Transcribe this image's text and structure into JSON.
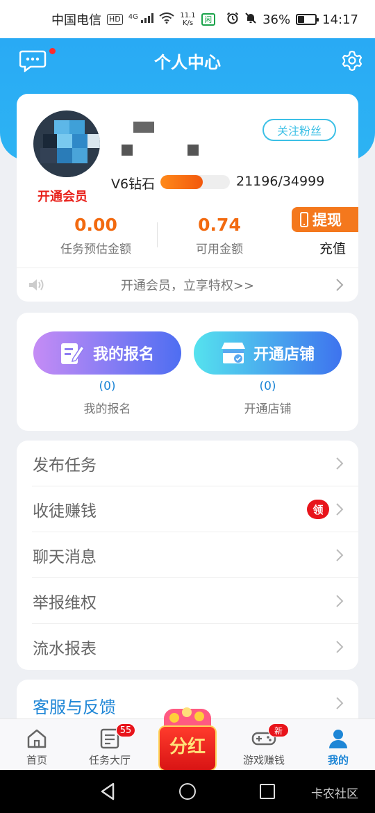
{
  "status_bar": {
    "carrier": "中国电信",
    "hd": "HD",
    "network": "4G",
    "speed_value": "11.1",
    "speed_unit": "K/s",
    "app_icon_text": "闲",
    "battery_percent": "36%",
    "battery_level": 0.36,
    "time": "14:17"
  },
  "header": {
    "title": "个人中心",
    "accent_color": "#2badf4"
  },
  "profile": {
    "open_vip_label": "开通会员",
    "follow_label": "关注粉丝",
    "level_label": "V6钻石",
    "level_current": 21196,
    "level_target": 34999,
    "level_text": "21196/34999",
    "task_amount": "0.00",
    "task_amount_label": "任务预估金额",
    "available_amount": "0.74",
    "available_amount_label": "可用金额",
    "withdraw_label": "提现",
    "recharge_label": "充值",
    "announcement": "开通会员，立享特权>>"
  },
  "signup": {
    "my_signup_label": "我的报名",
    "my_signup_count": "(0)",
    "my_signup_sub": "我的报名",
    "open_shop_label": "开通店铺",
    "open_shop_count": "(0)",
    "open_shop_sub": "开通店铺"
  },
  "menu": {
    "items": [
      {
        "label": "发布任务"
      },
      {
        "label": "收徒赚钱",
        "badge": "领"
      },
      {
        "label": "聊天消息"
      },
      {
        "label": "举报维权"
      },
      {
        "label": "流水报表"
      }
    ],
    "service_label": "客服与反馈"
  },
  "bottom_nav": {
    "home": "首页",
    "task_hall": "任务大厅",
    "task_hall_badge": "55",
    "center_label": "分红",
    "game": "游戏赚钱",
    "game_badge": "新",
    "mine": "我的"
  },
  "system_nav": {
    "brand": "卡农社区"
  }
}
